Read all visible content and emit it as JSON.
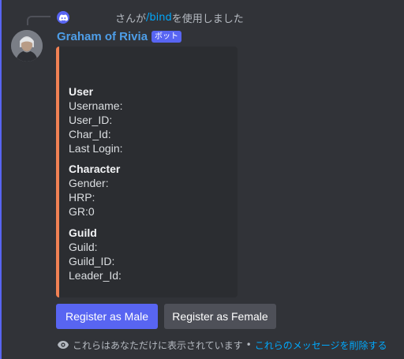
{
  "reply": {
    "author": "",
    "before": "さんが",
    "command": "/bind",
    "after": "を使用しました"
  },
  "message": {
    "author": "Graham of Rivia",
    "bot_badge": "ボット"
  },
  "embed": {
    "accent_color": "#f18154",
    "fields": [
      {
        "name": "User",
        "lines": [
          "Username:",
          "User_ID:",
          "Char_Id:",
          "Last Login:"
        ]
      },
      {
        "name": "Character",
        "lines": [
          "Gender:",
          "HRP:",
          "GR:0"
        ]
      },
      {
        "name": "Guild",
        "lines": [
          "Guild:",
          "Guild_ID:",
          "Leader_Id:"
        ]
      }
    ]
  },
  "buttons": {
    "male": "Register as Male",
    "female": "Register as Female"
  },
  "ephemeral": {
    "note": "これらはあなただけに表示されています",
    "separator": "•",
    "dismiss": "これらのメッセージを削除する"
  },
  "colors": {
    "brand": "#5865f2",
    "link": "#00a8fc",
    "background": "#313338",
    "embed_bg": "#2b2d31"
  },
  "icons": {
    "reply_app": "discord-icon",
    "ephemeral": "eye-icon"
  }
}
